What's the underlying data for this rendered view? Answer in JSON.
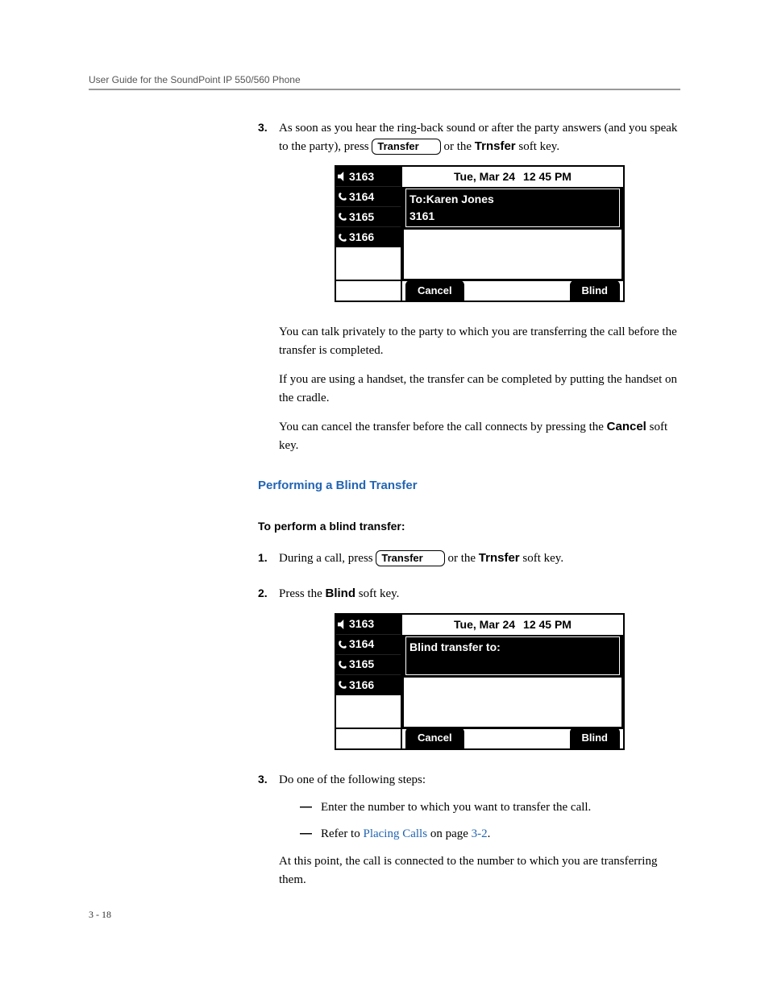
{
  "header": {
    "guide_title": "User Guide for the SoundPoint IP 550/560 Phone"
  },
  "step3_top": {
    "num": "3.",
    "text_a": "As soon as you hear the ring-back sound or after the party answers (and you speak to the party), press ",
    "transfer_label": "Transfer",
    "text_b": " or the ",
    "bold_key": "Trnsfer",
    "text_c": " soft key."
  },
  "screen1": {
    "lines": [
      "3163",
      "3164",
      "3165",
      "3166"
    ],
    "date": "Tue, Mar 24",
    "time": "12 45 PM",
    "to_label": "To:Karen Jones",
    "number": "3161",
    "softkeys": {
      "left": "Cancel",
      "right": "Blind"
    }
  },
  "post_screen1": {
    "p1": "You can talk privately to the party to which you are transferring the call before the transfer is completed.",
    "p2": "If you are using a handset, the transfer can be completed by putting the handset on the cradle.",
    "p3a": "You can cancel the transfer before the call connects by pressing the ",
    "p3bold": "Cancel",
    "p3b": " soft key."
  },
  "section": {
    "heading": "Performing a Blind Transfer",
    "subheading": "To perform a blind transfer:"
  },
  "step1": {
    "num": "1.",
    "text_a": "During a call, press ",
    "transfer_label": "Transfer",
    "text_b": " or the ",
    "bold_key": "Trnsfer",
    "text_c": " soft key."
  },
  "step2": {
    "num": "2.",
    "text_a": "Press the ",
    "bold_key": "Blind",
    "text_b": " soft key."
  },
  "screen2": {
    "lines": [
      "3163",
      "3164",
      "3165",
      "3166"
    ],
    "date": "Tue, Mar 24",
    "time": "12 45 PM",
    "prompt": "Blind transfer to:",
    "softkeys": {
      "left": "Cancel",
      "right": "Blind"
    }
  },
  "step3_bottom": {
    "num": "3.",
    "text": "Do one of the following steps:",
    "dash1": "Enter the number to which you want to transfer the call.",
    "dash2a": "Refer to ",
    "dash2link": "Placing Calls",
    "dash2b": " on page ",
    "dash2page": "3-2",
    "dash2c": ".",
    "final": "At this point, the call is connected to the number to which you are transferring them."
  },
  "footer": {
    "page": "3 - 18"
  }
}
